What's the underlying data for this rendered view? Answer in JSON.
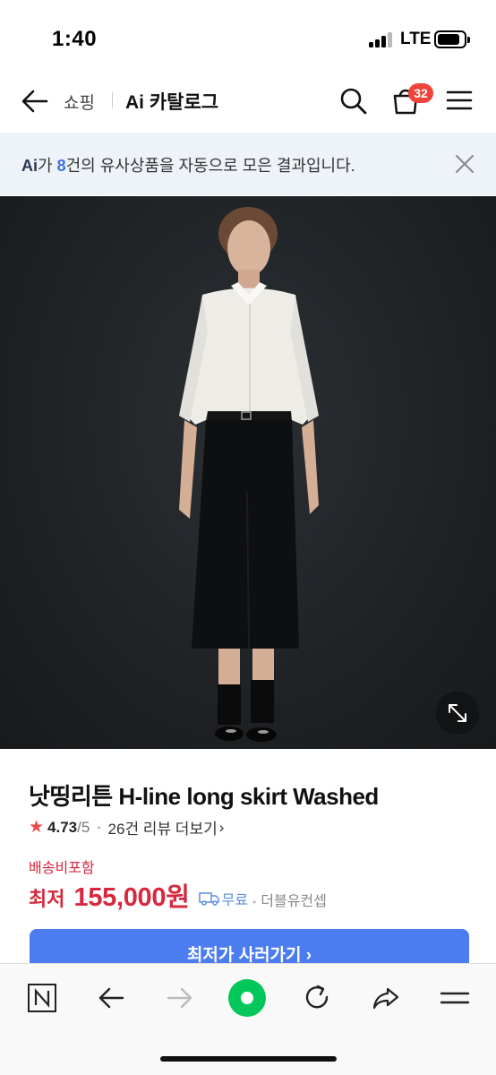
{
  "status_bar": {
    "time": "1:40",
    "network": "LTE"
  },
  "nav": {
    "section": "쇼핑",
    "title": "Ai 카탈로그",
    "cart_count": "32",
    "icons": [
      "back-arrow-icon",
      "search-icon",
      "cart-icon",
      "hamburger-menu-icon"
    ]
  },
  "ai_banner": {
    "logo": "Ai",
    "text_before": "가 ",
    "count": "8",
    "text_after": "건의 유사상품을 자동으로 모은 결과입니다.",
    "close_icon": "close-icon"
  },
  "product": {
    "title": "낫띵리튼 H-line long skirt Washed",
    "rating": "4.73",
    "rating_max": "/5",
    "review_link": "26건 리뷰 더보기",
    "shipping_note": "배송비포함",
    "price_prefix": "최저",
    "price": "155,000원",
    "free_shipping": "무료",
    "seller": "더블유컨셉",
    "cta": "최저가 사러가기"
  },
  "browser_toolbar": {
    "icons": [
      "naver-n-icon",
      "back-icon",
      "forward-icon",
      "green-home-icon",
      "reload-icon",
      "share-icon",
      "menu-icon"
    ]
  },
  "colors": {
    "accent_blue": "#4b7cf0",
    "price_red": "#d6283e",
    "badge_red": "#f0443a",
    "banner_bg": "#eef3f9",
    "green": "#03c75a"
  }
}
